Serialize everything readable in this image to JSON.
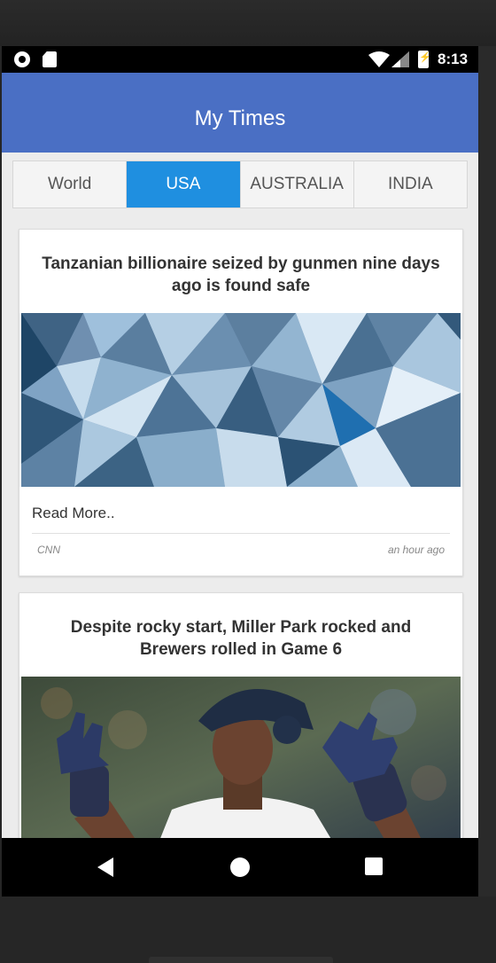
{
  "status_bar": {
    "time": "8:13",
    "icons": [
      "record-icon",
      "sd-card-icon",
      "wifi-icon",
      "signal-icon",
      "battery-charging-icon"
    ]
  },
  "app_bar": {
    "title": "My Times"
  },
  "tabs": [
    {
      "label": "World",
      "active": false
    },
    {
      "label": "USA",
      "active": true
    },
    {
      "label": "AUSTRALIA",
      "active": false
    },
    {
      "label": "INDIA",
      "active": false
    }
  ],
  "articles": [
    {
      "title": "Tanzanian billionaire seized by gunmen nine days ago is found safe",
      "image": "low-poly-blue-abstract",
      "read_more": "Read More..",
      "source": "CNN",
      "time_ago": "an hour ago"
    },
    {
      "title": "Despite rocky start, Miller Park rocked and Brewers rolled in Game 6",
      "image": "baseball-player-celebrating"
    }
  ],
  "nav_bar": {
    "icons": [
      "back-icon",
      "home-icon",
      "recents-icon"
    ]
  },
  "colors": {
    "app_bar": "#4a6fc4",
    "active_tab": "#1f8fe0",
    "background": "#ececec"
  }
}
